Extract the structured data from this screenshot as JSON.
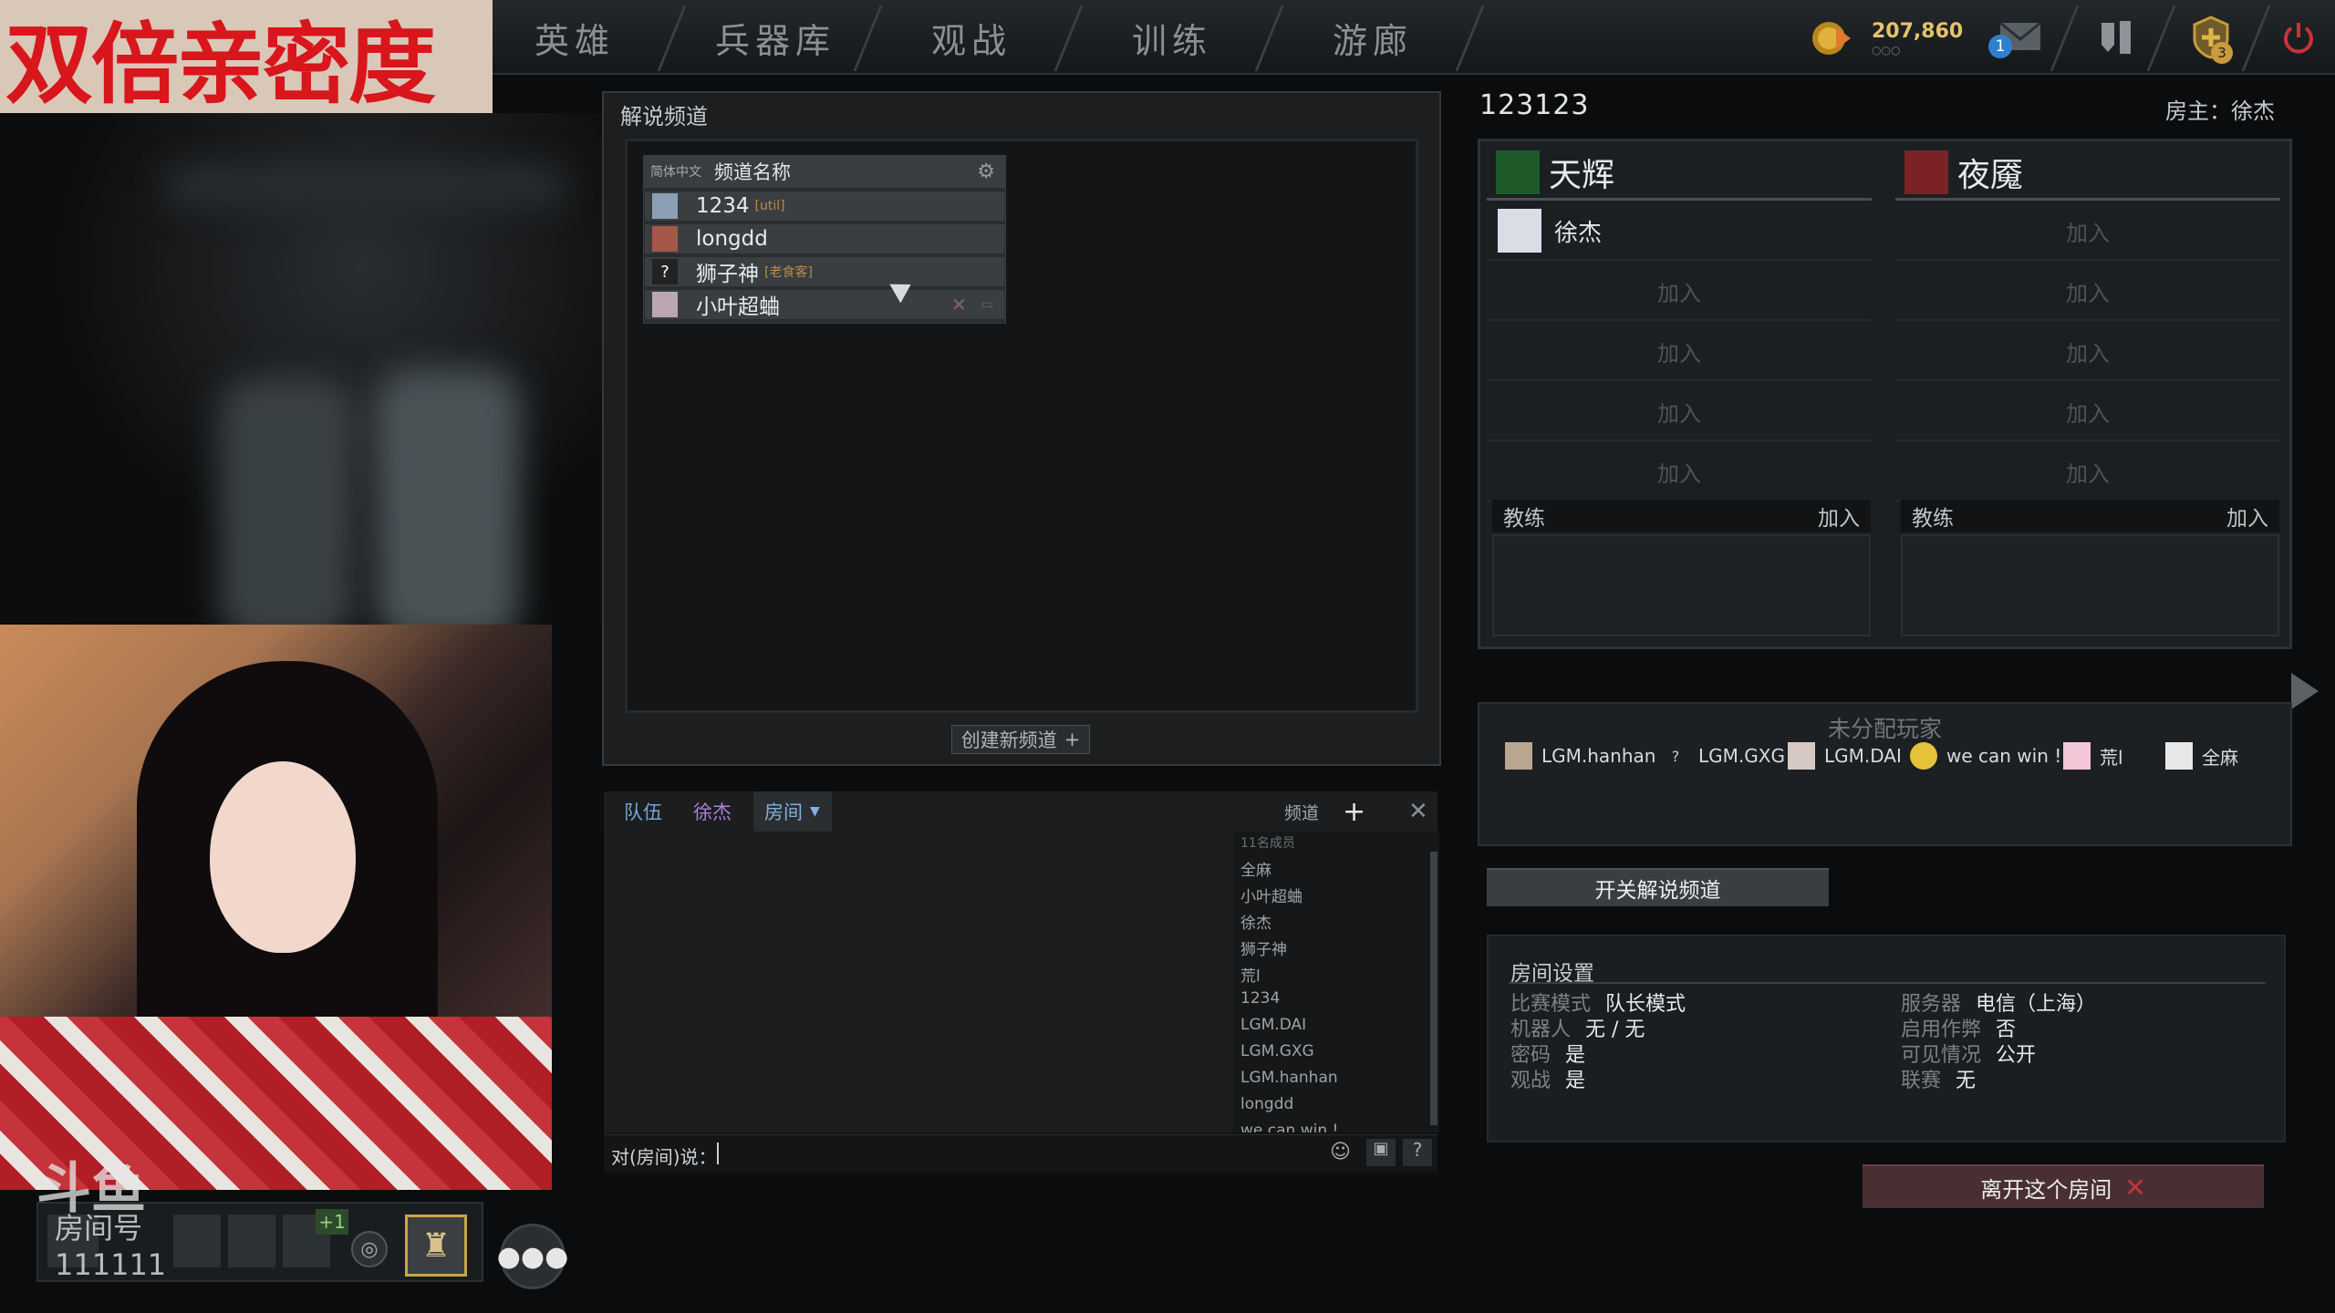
{
  "stream_overlay": {
    "title": "双倍亲密度",
    "watermark": "斗鱼",
    "room_label": "房间号",
    "room_number": "111111"
  },
  "topbar": {
    "tabs": [
      "英雄",
      "兵器库",
      "观战",
      "训练",
      "游廊"
    ],
    "currency": "207,860",
    "notifications_count": "1",
    "shield_count": "3",
    "icons": [
      "coins-icon",
      "mail-icon",
      "armory-icon",
      "shield-icon",
      "power-icon"
    ]
  },
  "broadcast": {
    "title": "解说频道",
    "lang_label": "简体中文",
    "header_label": "频道名称",
    "channels": [
      {
        "name": "1234",
        "tag": "[util]"
      },
      {
        "name": "longdd",
        "tag": ""
      },
      {
        "name": "狮子神",
        "tag": "[老食客]"
      },
      {
        "name": "小叶超蛐",
        "tag": ""
      }
    ],
    "create_label": "创建新频道"
  },
  "chat": {
    "tabs": [
      "队伍",
      "徐杰",
      "房间"
    ],
    "channel_label": "频道",
    "member_count": "11名成员",
    "members": [
      "全麻",
      "小叶超蛐",
      "徐杰",
      "狮子神",
      "荒l",
      "1234",
      "LGM.DAI",
      "LGM.GXG",
      "LGM.hanhan",
      "longdd",
      "we can win !"
    ],
    "input_prefix": "对(房间)说："
  },
  "lobby": {
    "name": "123123",
    "host_label": "房主：",
    "host_name": "徐杰",
    "radiant": {
      "name": "天辉",
      "player": "徐杰"
    },
    "dire": {
      "name": "夜魇"
    },
    "join_label": "加入",
    "coach_label": "教练",
    "unassigned_title": "未分配玩家",
    "unassigned": [
      "LGM.hanhan",
      "LGM.GXG",
      "LGM.DAI",
      "we can win !",
      "荒l",
      "全麻"
    ],
    "toggle_broadcast": "开关解说频道",
    "settings_title": "房间设置",
    "settings": {
      "mode_label": "比赛模式",
      "mode": "队长模式",
      "server_label": "服务器",
      "server": "电信（上海）",
      "bots_label": "机器人",
      "bots": "无 / 无",
      "cheats_label": "启用作弊",
      "cheats": "否",
      "password_label": "密码",
      "password": "是",
      "visibility_label": "可见情况",
      "visibility": "公开",
      "spectate_label": "观战",
      "spectate": "是",
      "league_label": "联赛",
      "league": "无"
    },
    "leave_label": "离开这个房间"
  },
  "colors": {
    "radiant": "#3a8f3a",
    "dire": "#b2373b",
    "accent_gold": "#d9a441"
  }
}
